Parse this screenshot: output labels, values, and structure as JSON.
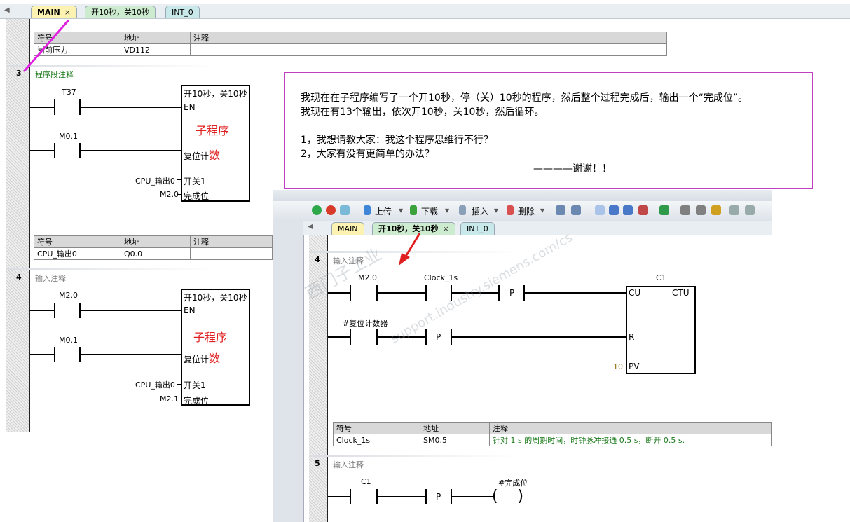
{
  "tabs": [
    {
      "label": "MAIN",
      "close": "×"
    },
    {
      "label": "开10秒，关10秒"
    },
    {
      "label": "INT_0"
    }
  ],
  "sym_header": {
    "symbol": "符号",
    "address": "地址",
    "comment": "注释"
  },
  "top_symbols": [
    {
      "symbol": "当前压力",
      "address": "VD112",
      "comment": ""
    }
  ],
  "net3": {
    "number": "3",
    "comment": "程序段注释",
    "contact1": "T37",
    "contact2": "M0.1",
    "box_title": "开10秒，关10秒",
    "pin_en": "EN",
    "box_name": "子程序",
    "pin_reset": "复位计",
    "pin_reset2": "数",
    "out1_addr": "CPU_输出0",
    "out1_pin": "开关1",
    "out2_addr": "M2.0",
    "out2_pin": "完成位",
    "symbols": [
      {
        "symbol": "CPU_输出0",
        "address": "Q0.0",
        "comment": ""
      }
    ]
  },
  "net4": {
    "number": "4",
    "comment": "输入注释",
    "contact1": "M2.0",
    "contact2": "M0.1",
    "box_title": "开10秒，关10秒",
    "pin_en": "EN",
    "box_name": "子程序",
    "pin_reset": "复位计",
    "pin_reset2": "数",
    "out1_addr": "CPU_输出0",
    "out1_pin": "开关1",
    "out2_addr": "M2.1",
    "out2_pin": "完成位"
  },
  "note": {
    "line1": "我现在在子程序编写了一个开10秒，停（关）10秒的程序，然后整个过程完成后，输出一个“完成位”。",
    "line2": "我现在有13个输出，依次开10秒，关10秒，然后循环。",
    "line3": "1，我想请教大家：我这个程序思维行不行？",
    "line4": "2，大家有没有更简单的办法？",
    "line5": "————谢谢！！"
  },
  "sub_window": {
    "toolbar": {
      "upload": "上传",
      "download": "下载",
      "insert": "插入",
      "delete": "删除"
    },
    "tabs": [
      {
        "label": "MAIN"
      },
      {
        "label": "开10秒，关10秒",
        "close": "×"
      },
      {
        "label": "INT_0"
      }
    ],
    "net4": {
      "number": "4",
      "comment": "输入注释",
      "contact1": "M2.0",
      "contact2": "Clock_1s",
      "p1": "P",
      "counter": "C1",
      "pin_cu": "CU",
      "ctu": "CTU",
      "contact3": "#复位计数器",
      "p2": "P",
      "pin_r": "R",
      "pv_value": "10",
      "pin_pv": "PV",
      "symbols": [
        {
          "symbol": "Clock_1s",
          "address": "SM0.5",
          "comment": "针对 1 s 的周期时间，时钟脉冲接通 0.5 s，断开 0.5 s."
        }
      ]
    },
    "net5": {
      "number": "5",
      "comment": "输入注释",
      "contact1": "C1",
      "p1": "P",
      "coil": "#完成位"
    }
  },
  "colors": {
    "accent_tab": "#fcf3b2",
    "tab_green": "#cdeccf",
    "note_border": "#c040c0",
    "comment_green": "#1a7a1a",
    "arrow": "#e020e0"
  }
}
